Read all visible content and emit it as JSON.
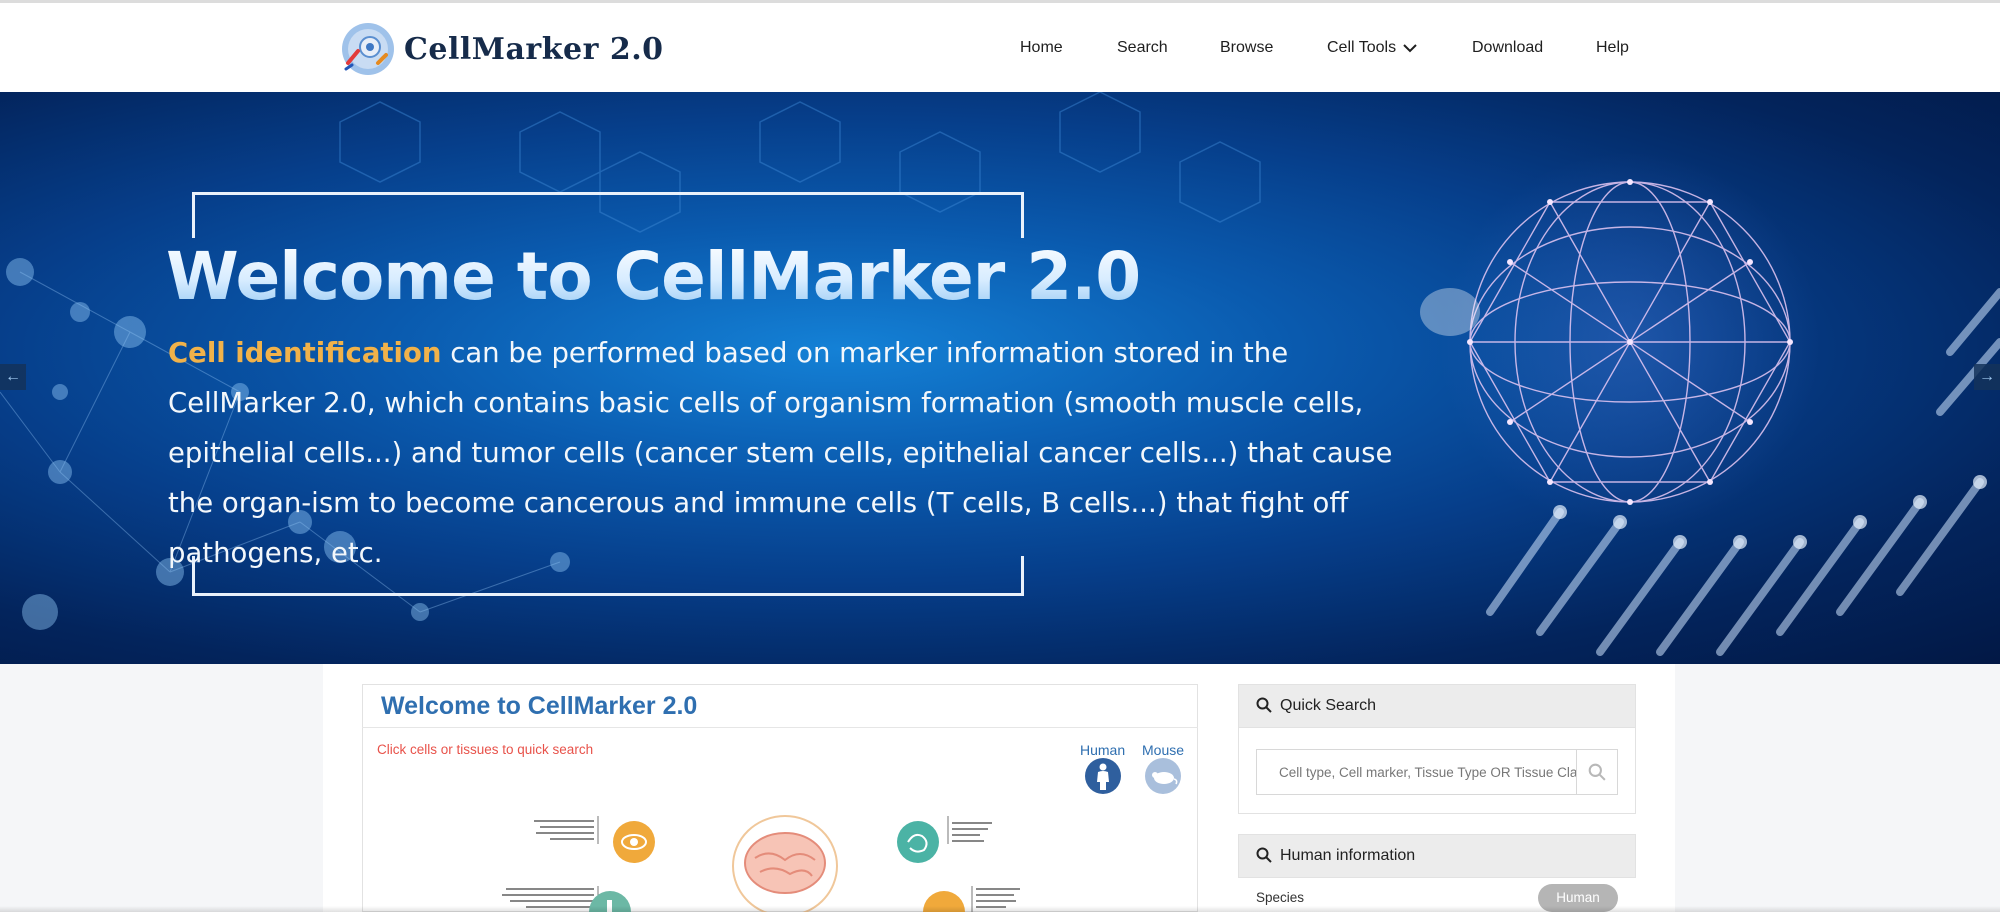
{
  "brand": {
    "name": "CellMarker 2.0"
  },
  "nav": {
    "items": [
      {
        "label": "Home"
      },
      {
        "label": "Search"
      },
      {
        "label": "Browse"
      },
      {
        "label": "Cell Tools"
      },
      {
        "label": "Download"
      },
      {
        "label": "Help"
      }
    ]
  },
  "hero": {
    "title": "Welcome to CellMarker 2.0",
    "highlight": "Cell identification",
    "description": " can be performed based on marker information stored in the CellMarker 2.0, which contains basic cells of organism formation (smooth muscle cells, epithelial cells...) and tumor cells (cancer stem cells, epithelial cancer cells...) that cause the organ-ism to become cancerous and immune cells (T cells, B cells...) that fight off pathogens, etc."
  },
  "main": {
    "title": "Welcome to CellMarker 2.0",
    "hint": "Click cells or tissues to quick search",
    "species_tabs": [
      {
        "label": "Human"
      },
      {
        "label": "Mouse"
      }
    ]
  },
  "quick_search": {
    "title": "Quick Search",
    "placeholder": "Cell type, Cell marker, Tissue Type OR Tissue Class"
  },
  "human_info": {
    "title": "Human information",
    "species_label": "Species",
    "species_value": "Human"
  },
  "colors": {
    "accent": "#2f6fb0",
    "hint": "#e8524a",
    "highlight": "#f1b24a"
  }
}
